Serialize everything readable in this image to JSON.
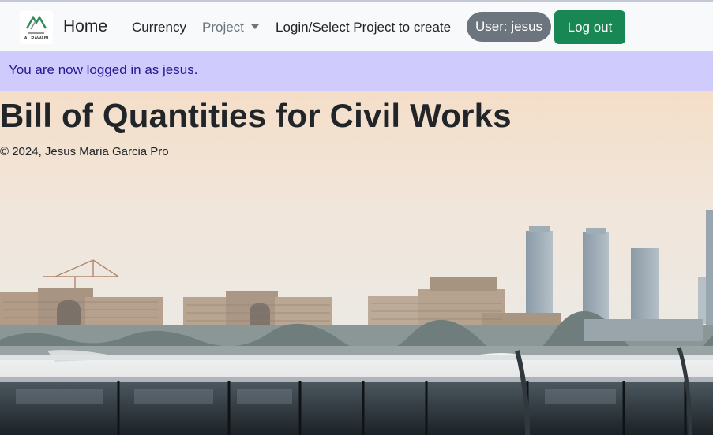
{
  "navbar": {
    "logo_text": "AL RAWABI",
    "brand": "Home",
    "links": {
      "currency": "Currency",
      "project": "Project",
      "login_select": "Login/Select Project to create"
    },
    "user_badge": "User: jesus",
    "logout": "Log out"
  },
  "alert": {
    "message": "You are now logged in as jesus."
  },
  "hero": {
    "title": "Bill of Quantities for Civil Works",
    "copyright": "© 2024, Jesus Maria Garcia Pro"
  },
  "colors": {
    "navbar_bg": "#f8f9fa",
    "alert_bg": "#cfcbfc",
    "alert_text": "#2a1891",
    "user_badge_bg": "#6c757d",
    "logout_bg": "#198754"
  }
}
